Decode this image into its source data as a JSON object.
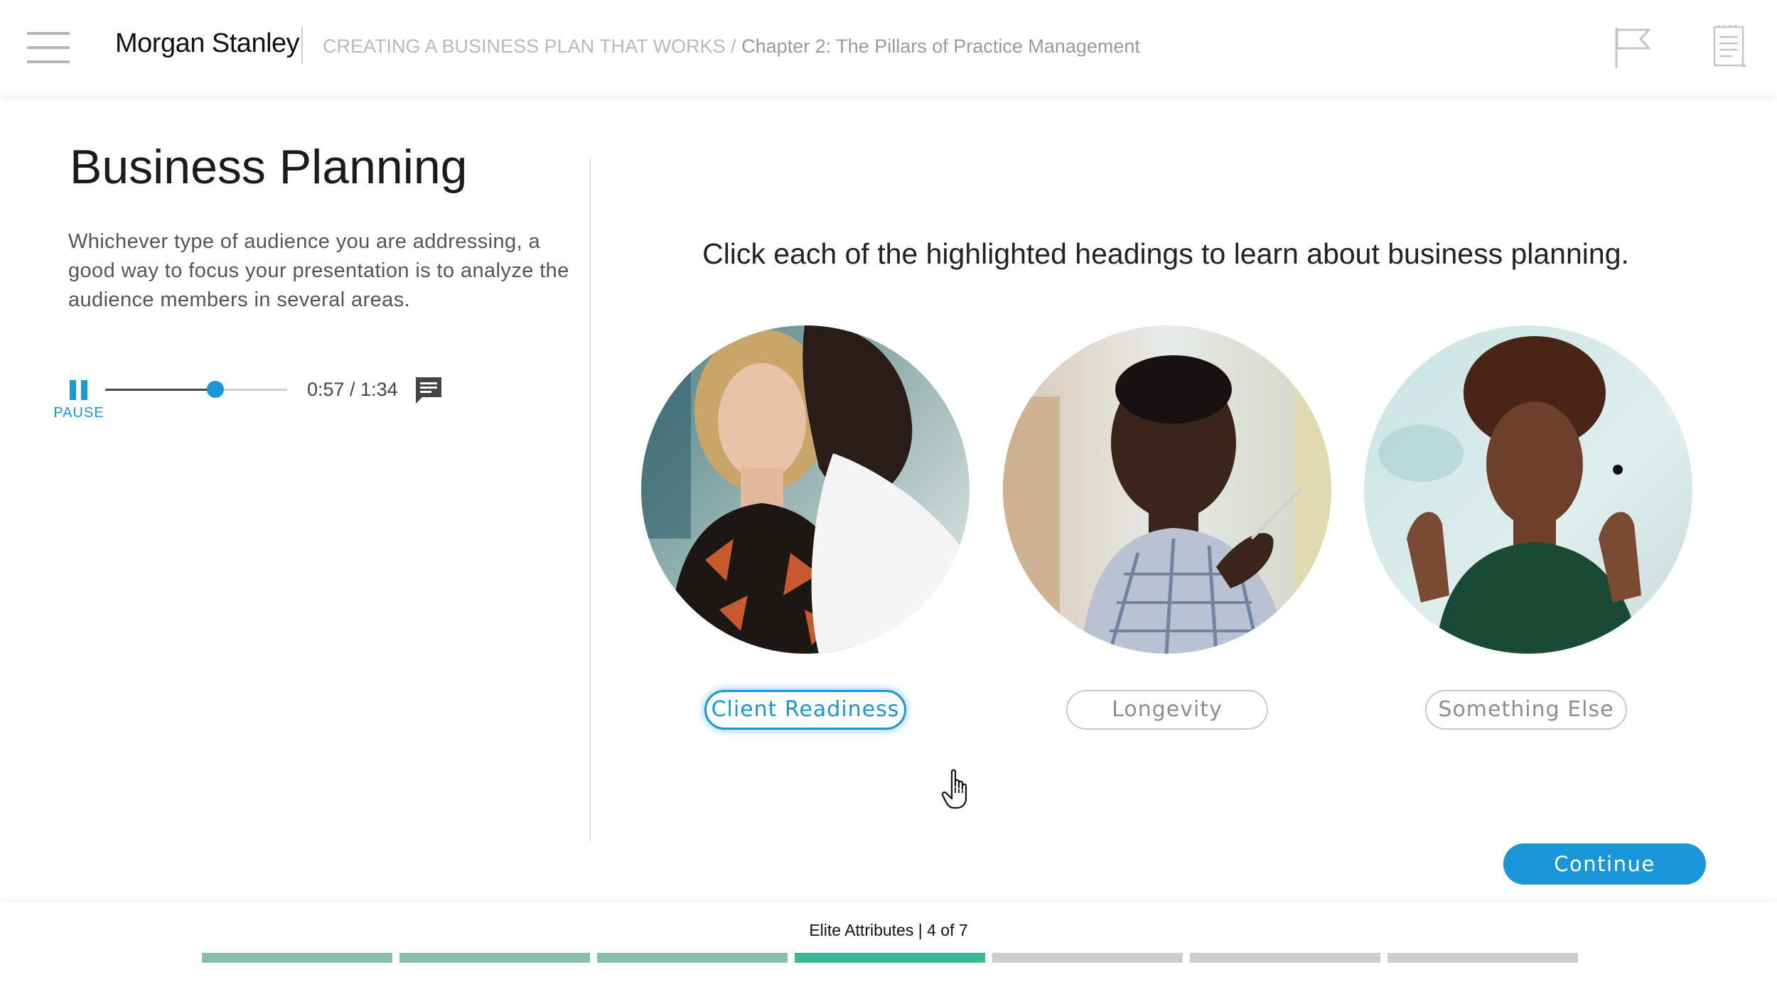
{
  "header": {
    "logo": "Morgan Stanley",
    "course": "CREATING A BUSINESS PLAN THAT WORKS",
    "separator": " / ",
    "chapter": "Chapter 2: The Pillars of Practice Management"
  },
  "lesson": {
    "title": "Business Planning",
    "description": "Whichever type of audience you are addressing, a good way to focus your presentation is to analyze the audience members in several areas."
  },
  "player": {
    "pause_label": "PAUSE",
    "time": "0:57 / 1:34",
    "progress_fraction": 0.606
  },
  "main": {
    "instruction": "Click each of the highlighted headings to learn about business planning.",
    "headings": [
      {
        "label": "Client Readiness",
        "active": true
      },
      {
        "label": "Longevity",
        "active": false
      },
      {
        "label": "Something Else",
        "active": false
      }
    ],
    "continue_label": "Continue"
  },
  "footer": {
    "progress_text": "Elite Attributes | 4 of 7",
    "total_segments": 7,
    "current_segment": 4,
    "colors": {
      "done": "#84bfaf",
      "current": "#3ab896",
      "todo": "#cdcdcd"
    }
  },
  "colors": {
    "accent": "#1a97d9"
  },
  "icons": [
    "menu-icon",
    "flag-icon",
    "notes-icon",
    "pause-icon",
    "captions-icon",
    "hand-pointer-cursor"
  ]
}
